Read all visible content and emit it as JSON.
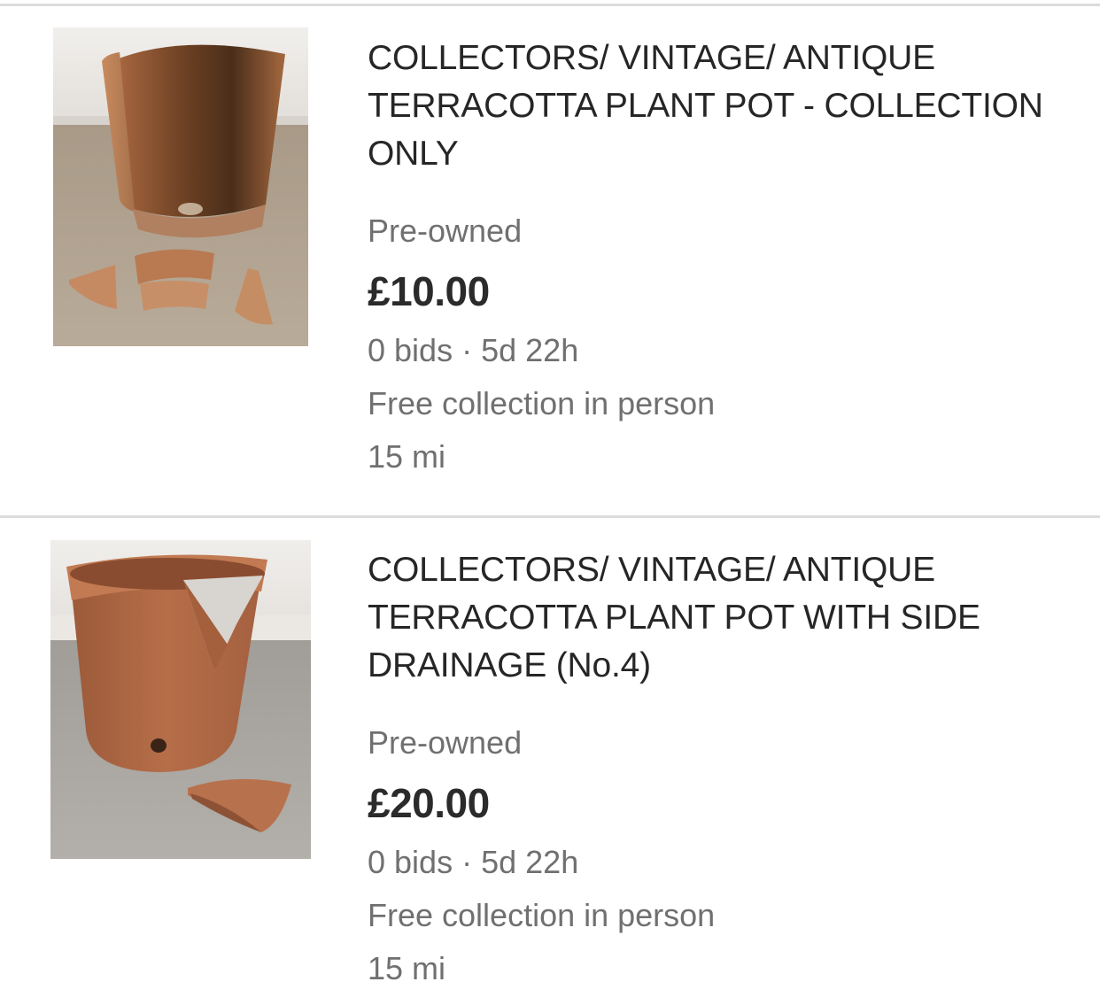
{
  "listings": [
    {
      "title": "COLLECTORS/ VINTAGE/ ANTIQUE TERRACOTTA PLANT POT - COLLECTION ONLY",
      "condition": "Pre-owned",
      "price": "£10.00",
      "bids": "0 bids",
      "separator": "·",
      "time_left": "5d 22h",
      "shipping": "Free collection in person",
      "distance": "15 mi",
      "image_icon": "broken-terracotta-pot-photo"
    },
    {
      "title": "COLLECTORS/ VINTAGE/ ANTIQUE TERRACOTTA PLANT POT WITH SIDE DRAINAGE (No.4)",
      "condition": "Pre-owned",
      "price": "£20.00",
      "bids": "0 bids",
      "separator": "·",
      "time_left": "5d 22h",
      "shipping": "Free collection in person",
      "distance": "15 mi",
      "image_icon": "chipped-terracotta-pot-photo"
    }
  ],
  "colors": {
    "title": "#262626",
    "secondary_text": "#707070",
    "divider": "#dcdcdc",
    "terracotta": "#b8714a"
  }
}
